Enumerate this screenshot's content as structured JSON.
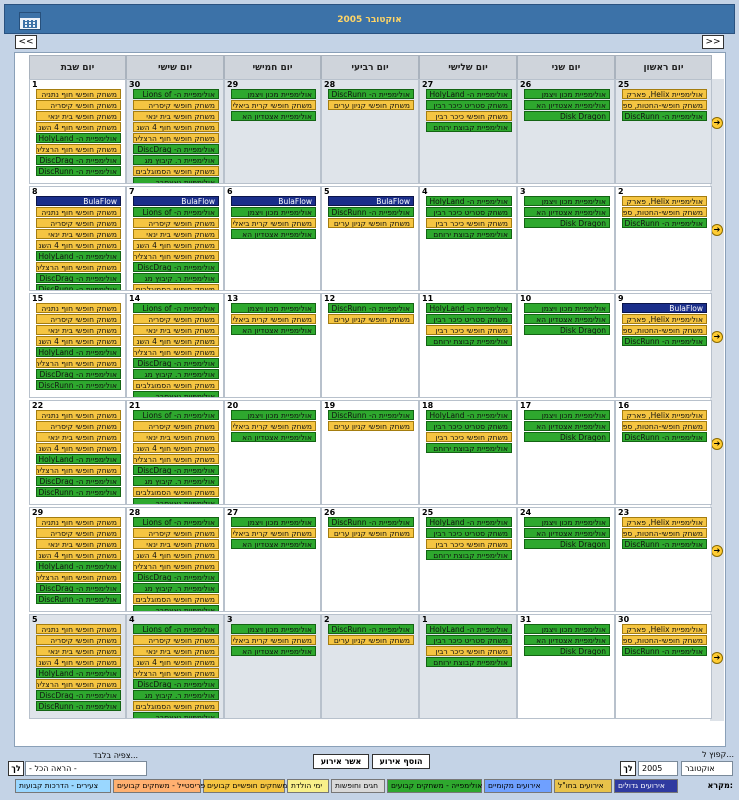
{
  "header": {
    "title": "אוקטובר 2005",
    "prev": "<<",
    "next": ">>"
  },
  "weekdays": [
    "יום ראשון",
    "יום שני",
    "יום שלישי",
    "יום רביעי",
    "יום חמישי",
    "יום שישי",
    "יום שבת"
  ],
  "ev": {
    "sun1": "אולימפיית Helix, פארק",
    "sun2": "משחק חופשי-החטות, ספור",
    "sun3": "אולימפיית ה- DiscRunn",
    "mon1": "אולימפיית מכון ויצמן",
    "mon2": "אולימפיית אצטדיון הא",
    "mon3": "Disk Dragon",
    "tue1": "אולימפיית ה- HolyLand",
    "tue2": "משחק סטריט כיכר רבין",
    "tue3": "משחק חופשי כיכר רבין",
    "tue4": "אולימפיית קבוצת ירוחם",
    "wed1": "אולימפיית ה- DiscRunn",
    "wed2": "משחק חופשי קניון ערים",
    "thu1": "אולימפיית מכון ויצמן",
    "thu2": "משחק חופשי קרית ביאליק",
    "thu3": "אולימפיית אצטדיון הא",
    "fri1": "אולימפיית ה- Lions of",
    "fri2": "משחק חופשי קיסריה",
    "fri3": "משחק חופשי בית ינאי",
    "fri4": "משחק חופשי חוף 4 השנ",
    "fri5": "משחק חופשי חוף הרצליה",
    "fri6": "אולימפיית ה- DiscDrag",
    "fri7": "אולימפיית ר. קיבוץ מג",
    "fri8": "משחק חופשי הסמוגלבים",
    "fri9": "אולימפיית גאצסבר",
    "sat1": "משחק חופשי חוף נתניה",
    "sat2": "משחק חופשי קיסריה",
    "sat3": "משחק חופשי בית ינאי",
    "sat4": "משחק חופשי חוף 4 השנ",
    "sat5": "אולימפיית ה- HolyLand",
    "sat6": "משחק חופשי חוף הרצליה",
    "sat7": "אולימפיית ה- DiscDrag",
    "sat8": "אולימפיית ה- DiscRunn",
    "bula": "BulaFlow"
  },
  "weeks": [
    {
      "days": [
        "25",
        "26",
        "27",
        "28",
        "29",
        "30",
        "1"
      ],
      "bula": []
    },
    {
      "days": [
        "2",
        "3",
        "4",
        "5",
        "6",
        "7",
        "8"
      ],
      "bula": [
        3,
        4,
        5,
        6
      ]
    },
    {
      "days": [
        "9",
        "10",
        "11",
        "12",
        "13",
        "14",
        "15"
      ],
      "bula": [
        0
      ]
    },
    {
      "days": [
        "16",
        "17",
        "18",
        "19",
        "20",
        "21",
        "22"
      ],
      "bula": []
    },
    {
      "days": [
        "23",
        "24",
        "25",
        "26",
        "27",
        "28",
        "29"
      ],
      "bula": []
    },
    {
      "days": [
        "30",
        "31",
        "1",
        "2",
        "3",
        "4",
        "5"
      ],
      "bula": []
    }
  ],
  "bottom": {
    "jump_label": "קפוץ ל...",
    "month": "אוקטובר",
    "year": "2005",
    "go": "לך",
    "add_event": "הוסף אירוע",
    "approve_event": "אשר אירוע",
    "view_label": "צפיה בלבד...",
    "view_value": "- הראה הכל -",
    "go2": "לך",
    "legend_title": "מקרא:",
    "legend": [
      "אירועים גדולים",
      "אירועים בחו\"ל",
      "אירועים מקומיים",
      "אולימפייה - משחקים קבועים",
      "חגים וחופשות",
      "ימי הולדת",
      "משחקים חופשיים קבועים",
      "פריסטייל - משחקים קבועים",
      "צעירים - הדרכות קבועות"
    ],
    "legend_colors": [
      "#2f3aa0",
      "#e8c24a",
      "#6fa0ff",
      "#2ea82e",
      "#d9d9d9",
      "#f8f08a",
      "#f5c542",
      "#ffb070",
      "#9ad7ff"
    ]
  }
}
